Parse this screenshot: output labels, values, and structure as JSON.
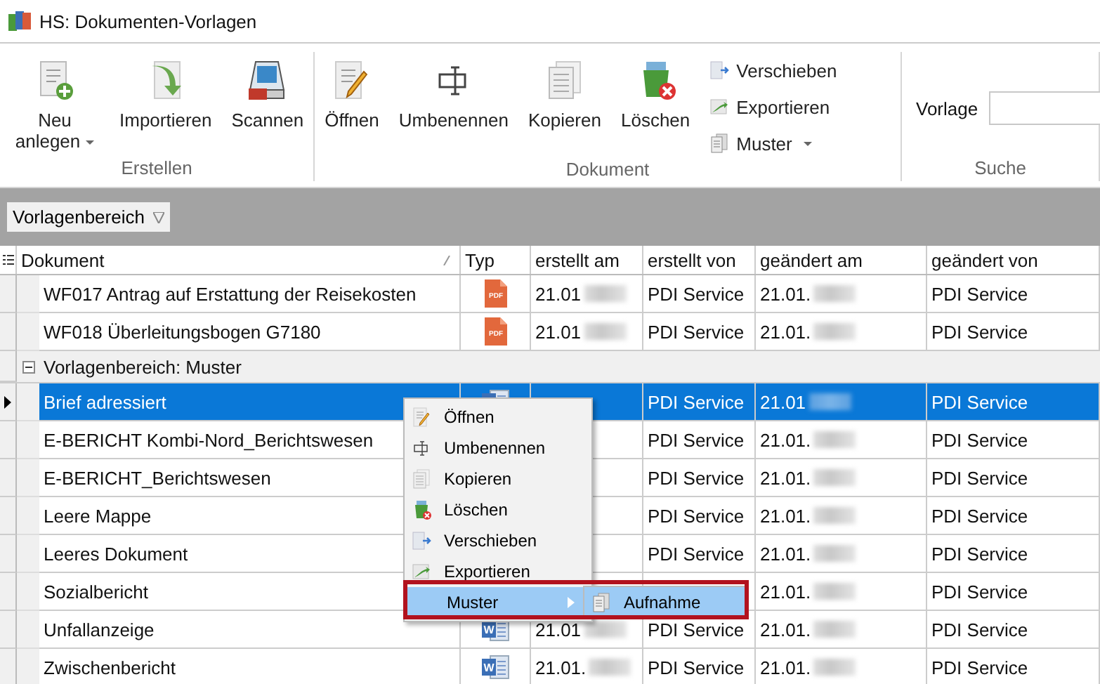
{
  "window": {
    "title": "HS: Dokumenten-Vorlagen"
  },
  "ribbon": {
    "groups": [
      {
        "label": "Erstellen",
        "buttons": [
          {
            "kind": "large",
            "label": "Neu anlegen",
            "dropdown": true
          },
          {
            "kind": "large",
            "label": "Importieren",
            "dropdown": false
          },
          {
            "kind": "large",
            "label": "Scannen",
            "dropdown": false
          }
        ]
      },
      {
        "label": "Dokument",
        "buttons": [
          {
            "kind": "large",
            "label": "Öffnen",
            "dropdown": false
          },
          {
            "kind": "large",
            "label": "Umbenennen",
            "dropdown": false
          },
          {
            "kind": "large",
            "label": "Kopieren",
            "dropdown": false
          },
          {
            "kind": "large",
            "label": "Löschen",
            "dropdown": false
          },
          {
            "kind": "small",
            "label": "Verschieben",
            "dropdown": false
          },
          {
            "kind": "small",
            "label": "Exportieren",
            "dropdown": false
          },
          {
            "kind": "small",
            "label": "Muster",
            "dropdown": true
          }
        ]
      },
      {
        "label": "Suche",
        "field": {
          "label": "Vorlage"
        }
      }
    ]
  },
  "grouping_bar": {
    "chip": "Vorlagenbereich"
  },
  "table": {
    "columns": [
      "Dokument",
      "Typ",
      "erstellt am",
      "erstellt von",
      "geändert am",
      "geändert von"
    ],
    "rows": [
      {
        "kind": "row",
        "selected": false,
        "document": "WF017 Antrag auf Erstattung der Reisekosten",
        "file": {
          "kind": "pdf",
          "label": "PDF"
        },
        "created": "21.01",
        "created_by": "PDI Service",
        "changed": "21.01.",
        "changed_by": "PDI Service"
      },
      {
        "kind": "row",
        "selected": false,
        "document": "WF018 Überleitungsbogen G7180",
        "file": {
          "kind": "pdf",
          "label": "PDF"
        },
        "created": "21.01",
        "created_by": "PDI Service",
        "changed": "21.01.",
        "changed_by": "PDI Service"
      },
      {
        "kind": "group",
        "label": "Vorlagenbereich: Muster",
        "expanded": true,
        "children": [
          {
            "kind": "row",
            "selected": true,
            "document": "Brief adressiert",
            "file": {
              "kind": "word"
            },
            "created_by": "PDI Service",
            "changed": "21.01",
            "changed_by": "PDI Service"
          },
          {
            "kind": "row",
            "selected": false,
            "document": "E-BERICHT Kombi-Nord_Berichtswesen",
            "created_by": "PDI Service",
            "changed": "21.01.",
            "changed_by": "PDI Service"
          },
          {
            "kind": "row",
            "selected": false,
            "document": "E-BERICHT_Berichtswesen",
            "created_by": "PDI Service",
            "changed": "21.01.",
            "changed_by": "PDI Service"
          },
          {
            "kind": "row",
            "selected": false,
            "document": "Leere Mappe",
            "created_by": "PDI Service",
            "changed": "21.01.",
            "changed_by": "PDI Service"
          },
          {
            "kind": "row",
            "selected": false,
            "document": "Leeres Dokument",
            "created_by": "PDI Service",
            "changed": "21.01.",
            "changed_by": "PDI Service"
          },
          {
            "kind": "row",
            "selected": false,
            "document": "Sozialbericht",
            "changed": "21.01.",
            "changed_by": "PDI Service"
          },
          {
            "kind": "row",
            "selected": false,
            "document": "Unfallanzeige",
            "file": {
              "kind": "word",
              "label": "W"
            },
            "created": "21.01",
            "created_by": "PDI Service",
            "changed": "21.01.",
            "changed_by": "PDI Service"
          },
          {
            "kind": "row",
            "selected": false,
            "document": "Zwischenbericht",
            "file": {
              "kind": "word",
              "label": "W"
            },
            "created": "21.01.",
            "created_by": "PDI Service",
            "changed": "21.01.",
            "changed_by": "PDI Service"
          }
        ]
      }
    ]
  },
  "context_menu": {
    "items": [
      {
        "label": "Öffnen",
        "highlighted": false
      },
      {
        "label": "Umbenennen",
        "highlighted": false
      },
      {
        "label": "Kopieren",
        "highlighted": false
      },
      {
        "label": "Löschen",
        "highlighted": false
      },
      {
        "label": "Verschieben",
        "highlighted": false
      },
      {
        "label": "Exportieren",
        "highlighted": false
      },
      {
        "label": "Muster",
        "highlighted": true,
        "marked": true,
        "submenu": {
          "items": [
            {
              "label": "Aufnahme",
              "highlighted": true
            }
          ]
        }
      }
    ]
  }
}
